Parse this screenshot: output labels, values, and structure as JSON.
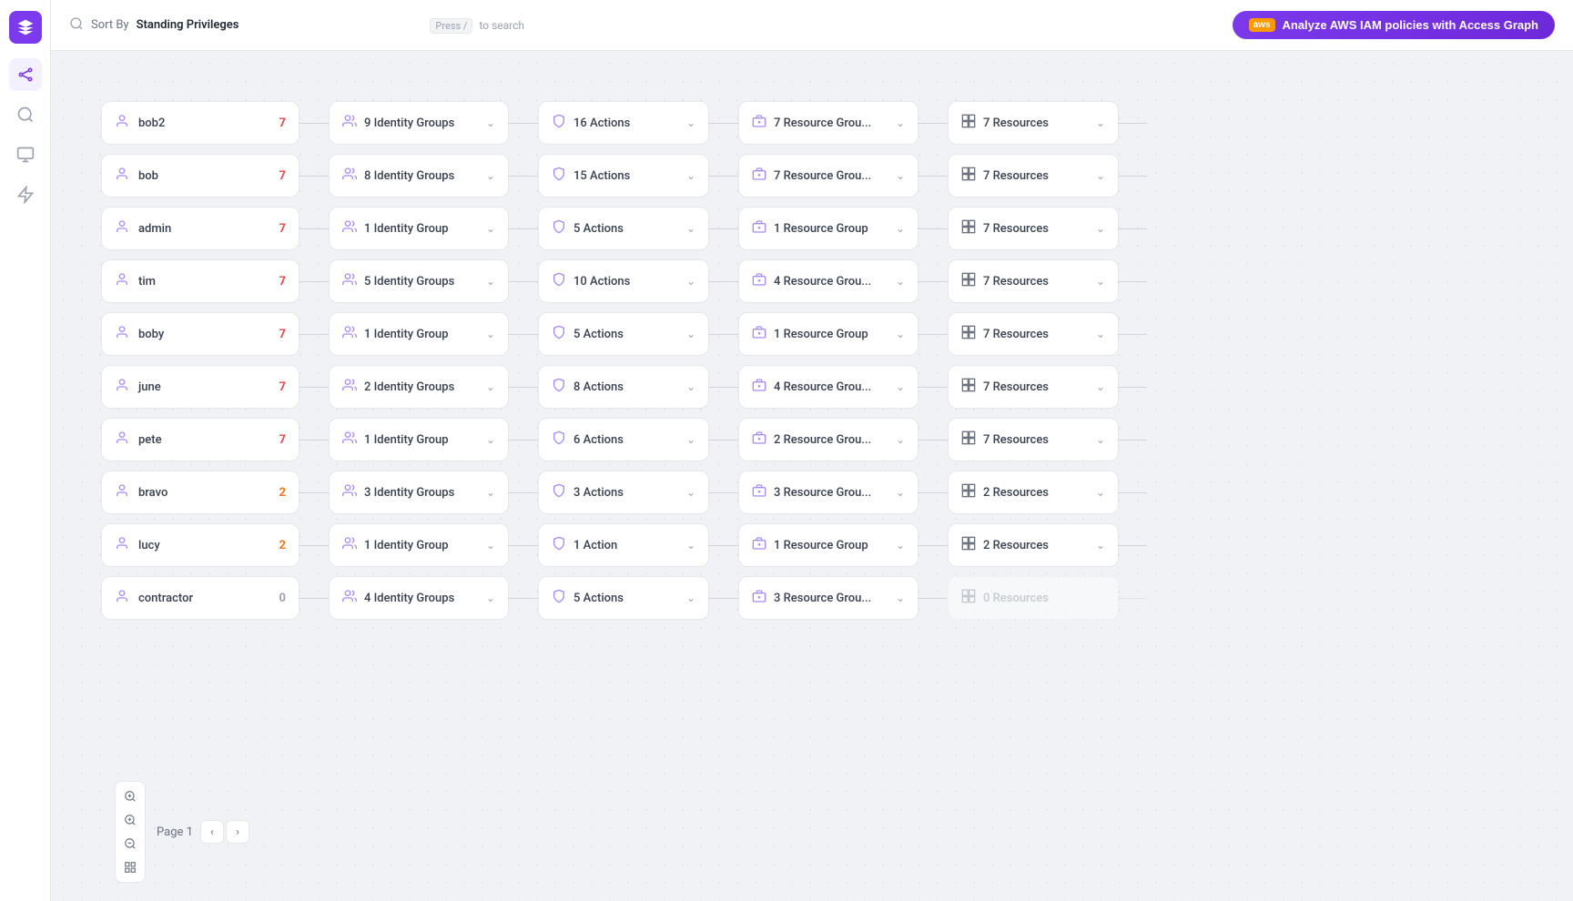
{
  "sidebar": {
    "logo_label": "App Logo",
    "items": [
      {
        "id": "graph",
        "icon": "⬡",
        "label": "Graph",
        "active": true
      },
      {
        "id": "search",
        "icon": "⌕",
        "label": "Search",
        "active": false
      },
      {
        "id": "monitor",
        "icon": "▣",
        "label": "Monitor",
        "active": false
      },
      {
        "id": "lightning",
        "icon": "⚡",
        "label": "Lightning",
        "active": false
      }
    ]
  },
  "topbar": {
    "search_placeholder": "Sort By  Standing Privileges",
    "sort_by_label": "Sort By",
    "sort_value": "Standing Privileges",
    "search_hint_press": "Press",
    "search_hint_key": "/",
    "search_hint_text": "to search",
    "analyze_btn_label": "Analyze AWS IAM policies with Access Graph",
    "aws_label": "aws"
  },
  "rows": [
    {
      "user": {
        "name": "bob2",
        "score": 7,
        "score_class": ""
      },
      "identity_groups": {
        "count": 9,
        "label": "Identity Groups"
      },
      "actions": {
        "count": 16,
        "label": "Actions"
      },
      "resource_groups": {
        "count": 7,
        "label": "Resource Grou..."
      },
      "resources": {
        "count": 7,
        "label": "Resources"
      }
    },
    {
      "user": {
        "name": "bob",
        "score": 7,
        "score_class": ""
      },
      "identity_groups": {
        "count": 8,
        "label": "Identity Groups"
      },
      "actions": {
        "count": 15,
        "label": "Actions"
      },
      "resource_groups": {
        "count": 7,
        "label": "Resource Grou..."
      },
      "resources": {
        "count": 7,
        "label": "Resources"
      }
    },
    {
      "user": {
        "name": "admin",
        "score": 7,
        "score_class": ""
      },
      "identity_groups": {
        "count": 1,
        "label": "Identity Group"
      },
      "actions": {
        "count": 5,
        "label": "Actions"
      },
      "resource_groups": {
        "count": 1,
        "label": "Resource Group"
      },
      "resources": {
        "count": 7,
        "label": "Resources"
      }
    },
    {
      "user": {
        "name": "tim",
        "score": 7,
        "score_class": ""
      },
      "identity_groups": {
        "count": 5,
        "label": "Identity Groups"
      },
      "actions": {
        "count": 10,
        "label": "Actions"
      },
      "resource_groups": {
        "count": 4,
        "label": "Resource Grou..."
      },
      "resources": {
        "count": 7,
        "label": "Resources"
      }
    },
    {
      "user": {
        "name": "boby",
        "score": 7,
        "score_class": ""
      },
      "identity_groups": {
        "count": 1,
        "label": "Identity Group"
      },
      "actions": {
        "count": 5,
        "label": "Actions"
      },
      "resource_groups": {
        "count": 1,
        "label": "Resource Group"
      },
      "resources": {
        "count": 7,
        "label": "Resources"
      }
    },
    {
      "user": {
        "name": "june",
        "score": 7,
        "score_class": ""
      },
      "identity_groups": {
        "count": 2,
        "label": "Identity Groups"
      },
      "actions": {
        "count": 8,
        "label": "Actions"
      },
      "resource_groups": {
        "count": 4,
        "label": "Resource Grou..."
      },
      "resources": {
        "count": 7,
        "label": "Resources"
      }
    },
    {
      "user": {
        "name": "pete",
        "score": 7,
        "score_class": ""
      },
      "identity_groups": {
        "count": 1,
        "label": "Identity Group"
      },
      "actions": {
        "count": 6,
        "label": "Actions"
      },
      "resource_groups": {
        "count": 2,
        "label": "Resource Grou..."
      },
      "resources": {
        "count": 7,
        "label": "Resources"
      }
    },
    {
      "user": {
        "name": "bravo",
        "score": 2,
        "score_class": "score-2"
      },
      "identity_groups": {
        "count": 3,
        "label": "Identity Groups"
      },
      "actions": {
        "count": 3,
        "label": "Actions"
      },
      "resource_groups": {
        "count": 3,
        "label": "Resource Grou..."
      },
      "resources": {
        "count": 2,
        "label": "Resources"
      }
    },
    {
      "user": {
        "name": "lucy",
        "score": 2,
        "score_class": "score-2"
      },
      "identity_groups": {
        "count": 1,
        "label": "Identity Group"
      },
      "actions": {
        "count": 1,
        "label": "Action"
      },
      "resource_groups": {
        "count": 1,
        "label": "Resource Group"
      },
      "resources": {
        "count": 2,
        "label": "Resources"
      }
    },
    {
      "user": {
        "name": "contractor",
        "score": 0,
        "score_class": "score-0"
      },
      "identity_groups": {
        "count": 4,
        "label": "Identity Groups"
      },
      "actions": {
        "count": 5,
        "label": "Actions"
      },
      "resource_groups": {
        "count": 3,
        "label": "Resource Grou..."
      },
      "resources": {
        "count": 0,
        "label": "Resources",
        "disabled": true
      }
    }
  ],
  "pagination": {
    "page_label": "Page 1"
  },
  "zoom": {
    "fit_icon": "⊕",
    "zoom_in_icon": "+",
    "zoom_out_icon": "−",
    "reset_icon": "⊞"
  }
}
